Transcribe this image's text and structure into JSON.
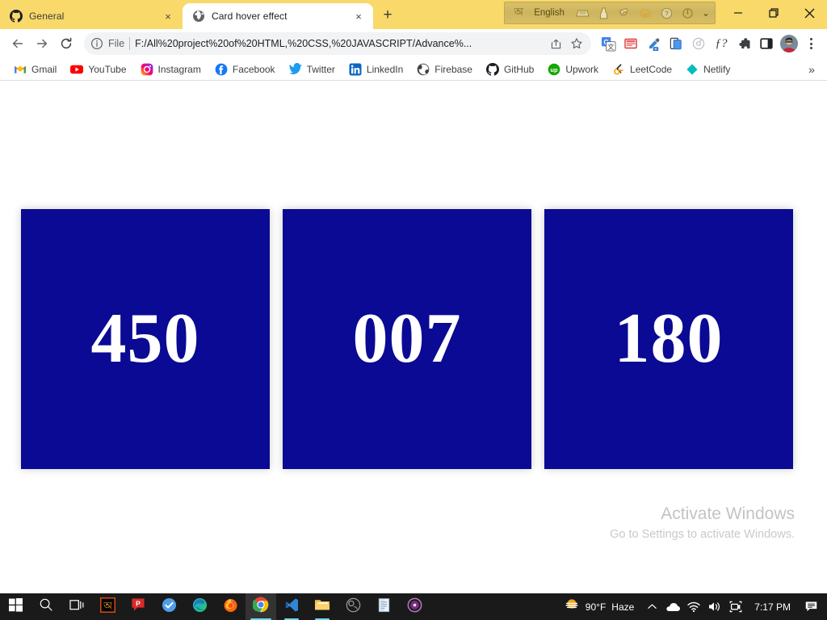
{
  "browser": {
    "tabs": [
      {
        "title": "General",
        "favicon": "github-icon",
        "active": false,
        "close_label": "×"
      },
      {
        "title": "Card hover effect",
        "favicon": "globe-icon",
        "active": true,
        "close_label": "×"
      }
    ],
    "new_tab_label": "+",
    "ime": {
      "layout_icon": "bangla-glyph-icon",
      "language": "English",
      "icons": [
        "keyboard-icon",
        "mouse-pad-icon",
        "gear-icon",
        "internet-explorer-icon",
        "help-icon",
        "power-icon"
      ],
      "chevron": "⌄"
    },
    "window_controls": {
      "minimize": "—",
      "maximize": "❐",
      "close": "✕"
    },
    "toolbar": {
      "back": "←",
      "forward": "→",
      "reload": "⟳",
      "omnibox": {
        "info_icon": "info-circle-icon",
        "scheme": "File",
        "url": "F:/All%20project%20of%20HTML,%20CSS,%20JAVASCRIPT/Advance%...",
        "share_icon": "share-icon",
        "bookmark_icon": "star-icon"
      },
      "extensions": [
        "google-translate-icon",
        "reader-list-icon",
        "eyedropper-icon",
        "tab-copy-icon",
        "circle-target-icon",
        "font-finder-icon",
        "puzzle-extensions-icon",
        "side-panel-icon"
      ],
      "profile": "avatar",
      "menu": "kebab-menu-icon"
    },
    "bookmarks": [
      {
        "label": "Gmail",
        "icon": "gmail-icon"
      },
      {
        "label": "YouTube",
        "icon": "youtube-icon"
      },
      {
        "label": "Instagram",
        "icon": "instagram-icon"
      },
      {
        "label": "Facebook",
        "icon": "facebook-icon"
      },
      {
        "label": "Twitter",
        "icon": "twitter-icon"
      },
      {
        "label": "LinkedIn",
        "icon": "linkedin-icon"
      },
      {
        "label": "Firebase",
        "icon": "firebase-icon"
      },
      {
        "label": "GitHub",
        "icon": "github-icon"
      },
      {
        "label": "Upwork",
        "icon": "upwork-icon"
      },
      {
        "label": "LeetCode",
        "icon": "leetcode-icon"
      },
      {
        "label": "Netlify",
        "icon": "netlify-icon"
      }
    ],
    "bookmarks_overflow": "»"
  },
  "page": {
    "background": "#ffffff",
    "card_color": "#0a0a94",
    "card_text_color": "#ffffff",
    "cards": [
      {
        "number": "450"
      },
      {
        "number": "007"
      },
      {
        "number": "180"
      }
    ]
  },
  "watermark": {
    "title": "Activate Windows",
    "subtitle": "Go to Settings to activate Windows."
  },
  "taskbar": {
    "background": "#1a1a1a",
    "items": [
      {
        "name": "start-button",
        "icon": "windows-logo-icon"
      },
      {
        "name": "search-button",
        "icon": "search-icon"
      },
      {
        "name": "task-view-button",
        "icon": "task-view-icon"
      },
      {
        "name": "avro-keyboard",
        "icon": "avro-keyboard-icon"
      },
      {
        "name": "potplayer",
        "icon": "potplayer-icon"
      },
      {
        "name": "todoist",
        "icon": "blue-check-icon"
      },
      {
        "name": "microsoft-edge",
        "icon": "edge-icon"
      },
      {
        "name": "firefox",
        "icon": "firefox-icon"
      },
      {
        "name": "google-chrome",
        "icon": "chrome-icon"
      },
      {
        "name": "vs-code",
        "icon": "vscode-icon"
      },
      {
        "name": "file-explorer",
        "icon": "folder-icon"
      },
      {
        "name": "obs-studio",
        "icon": "obs-icon"
      },
      {
        "name": "notepad",
        "icon": "notepad-icon"
      },
      {
        "name": "media-player",
        "icon": "disc-icon"
      }
    ],
    "tray": {
      "weather_temp": "90°F",
      "weather_condition": "Haze",
      "weather_icon": "sun-haze-icon",
      "overflow": "∧",
      "icons": [
        "onedrive-cloud-icon",
        "wifi-icon",
        "volume-icon",
        "screen-capture-icon"
      ],
      "clock": "7:17 PM",
      "notifications": "notification-icon"
    }
  }
}
